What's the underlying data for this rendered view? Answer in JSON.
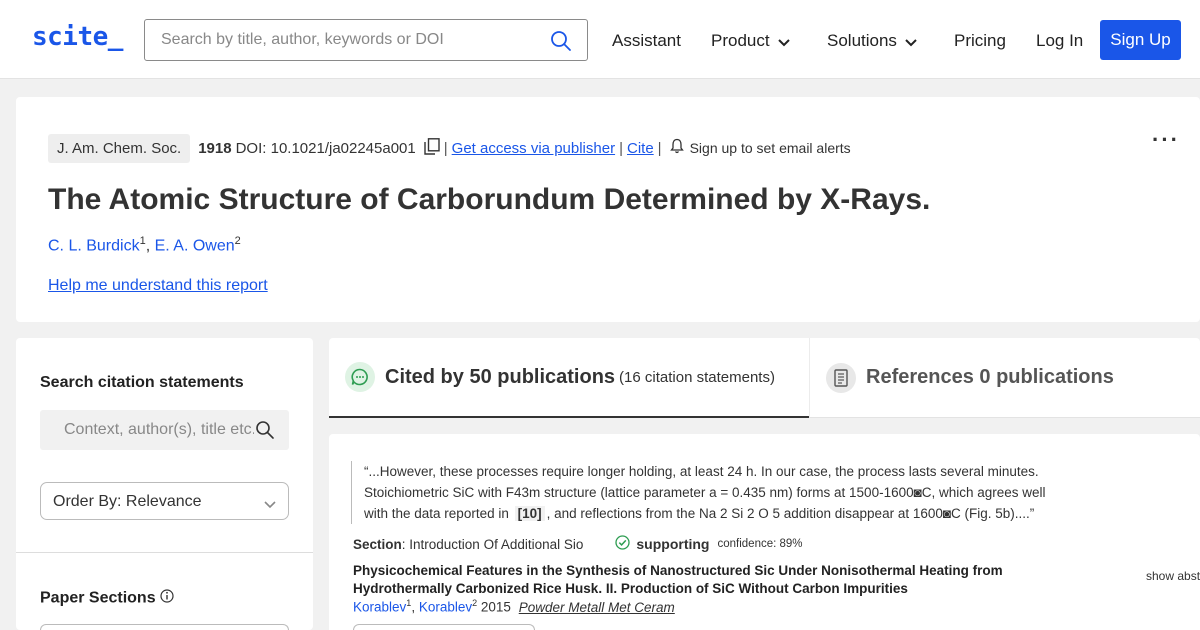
{
  "nav": {
    "logo": "scite_",
    "search_placeholder": "Search by title, author, keywords or DOI",
    "links": [
      "Assistant",
      "Product",
      "Solutions",
      "Pricing",
      "Log In"
    ],
    "signup": "Sign Up",
    "accent": "#1a56e8"
  },
  "paper": {
    "journal": "J. Am. Chem. Soc.",
    "year": "1918",
    "doi": "DOI: 10.1021/ja02245a001",
    "access": "Get access via publisher",
    "cite": "Cite",
    "alerts": "Sign up to set email alerts",
    "more": "···",
    "title": "The Atomic Structure of Carborundum Determined by X-Rays.",
    "authors": [
      {
        "name": "C. L. Burdick",
        "sup": "1"
      },
      {
        "name": "E. A. Owen",
        "sup": "2"
      }
    ],
    "help": "Help me understand this report"
  },
  "sidebar": {
    "search_heading": "Search citation statements",
    "search_placeholder": "Context, author(s), title etc.",
    "order_by": "Order By: Relevance",
    "sections_heading": "Paper Sections"
  },
  "tabs": {
    "cited_main": "Cited by 50 publications",
    "cited_sub": "(16 citation statements)",
    "refs_main": "References 0 publications"
  },
  "result": {
    "quote_pre": "“...However, these processes require longer holding, at least 24 h. In our case, the process lasts several minutes. Stoichiometric SiC with F43m structure (lattice parameter a = 0.435 nm) forms at 1500-1600◙C, which agrees well with the data reported in",
    "quote_ref": "[10]",
    "quote_post": ", and reflections from the Na 2 Si 2 O 5 addition disappear at 1600◙C (Fig. 5b)....”",
    "section_label": "Section",
    "section_value": ": Introduction Of Additional Sio",
    "classification": "supporting",
    "confidence": "confidence: 89%",
    "title": "Physicochemical Features in the Synthesis of Nanostructured Sic Under Nonisothermal Heating from Hydrothermally Carbonized Rice Husk. II. Production of SiC Without Carbon Impurities",
    "show_abstract": "show abst",
    "authors": [
      {
        "name": "Korablev",
        "sup": "1"
      },
      {
        "name": "Korablev",
        "sup": "2"
      }
    ],
    "year": "2015",
    "journal": "Powder Metall Met Ceram"
  }
}
